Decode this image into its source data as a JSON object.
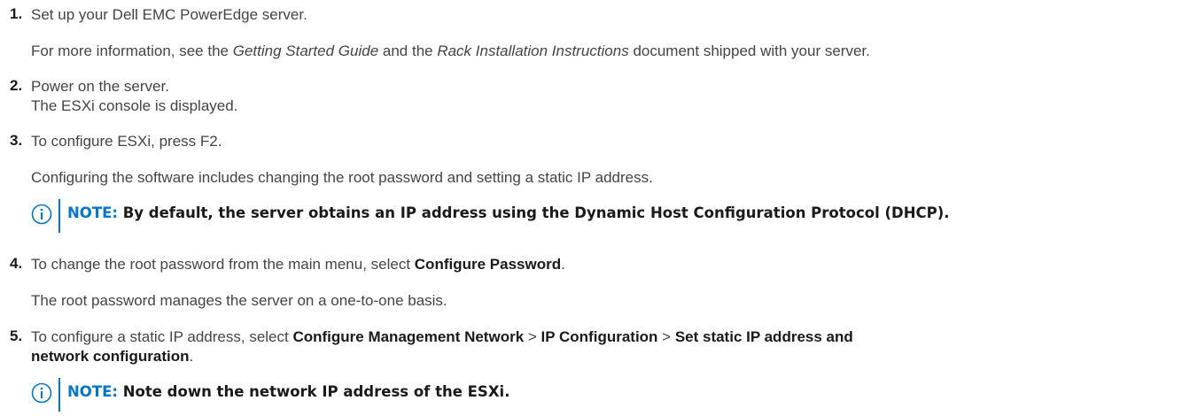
{
  "colors": {
    "accent": "#0076ce",
    "text": "#444444",
    "strong": "#1a1a1a"
  },
  "steps": [
    {
      "num": "1.",
      "line1": "Set up your Dell EMC PowerEdge server.",
      "line2_a": "For more information, see the ",
      "line2_i1": "Getting Started Guide",
      "line2_b": " and the ",
      "line2_i2": "Rack Installation Instructions",
      "line2_c": " document shipped with your server."
    },
    {
      "num": "2.",
      "line1": "Power on the server.",
      "line2": "The ESXi console is displayed."
    },
    {
      "num": "3.",
      "line1": "To configure ESXi, press F2.",
      "line2": "Configuring the software includes changing the root password and setting a static IP address.",
      "note_label": "NOTE:",
      "note_text": " By default, the server obtains an IP address using the Dynamic Host Configuration Protocol (DHCP)."
    },
    {
      "num": "4.",
      "line1_a": "To change the root password from the main menu, select ",
      "line1_b": "Configure Password",
      "line1_c": ".",
      "line2": "The root password manages the server on a one-to-one basis."
    },
    {
      "num": "5.",
      "line1_a": "To configure a static IP address, select ",
      "line1_b": "Configure Management Network",
      "line1_c": " > ",
      "line1_d": "IP Configuration",
      "line1_e": " > ",
      "line1_f": "Set static IP address and",
      "line2_b": "network configuration",
      "line2_c": ".",
      "note_label": "NOTE:",
      "note_text": " Note down the network IP address of the ESXi."
    }
  ]
}
